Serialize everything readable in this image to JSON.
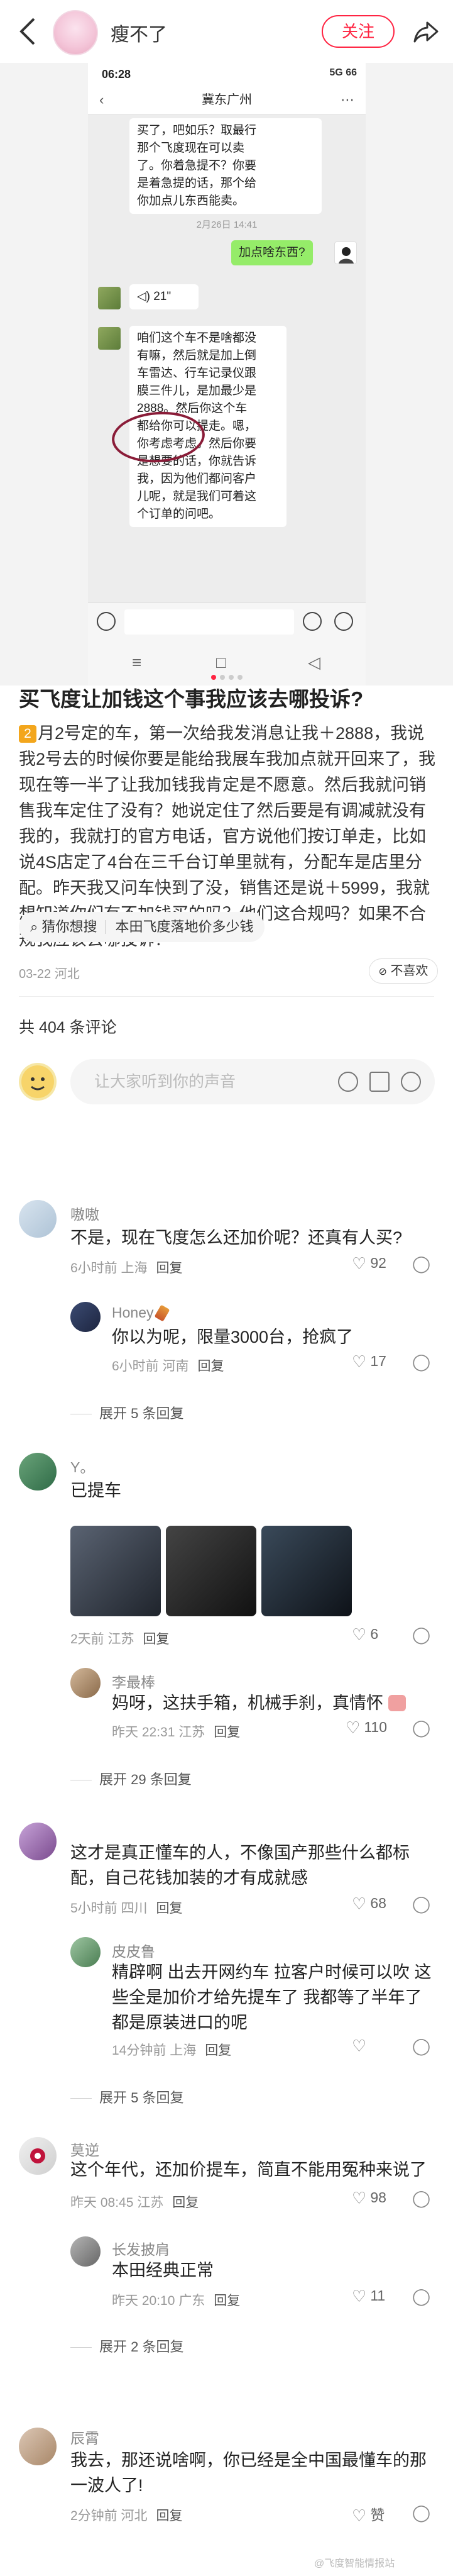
{
  "header": {
    "username": "瘦不了",
    "follow_label": "关注"
  },
  "screenshot": {
    "status_time": "06:28",
    "status_right": "5G 66",
    "chat_title": "冀东广州",
    "msg_top": "买了，吧如乐？取最行\n那个飞度现在可以卖\n了。你着急提不？你要\n是着急提的话，那个给\n你加点儿东西能卖。",
    "time_label": "2月26日 14:41",
    "my_msg": "加点啥东西?",
    "voice": "21\"",
    "msg_bottom": "咱们这个车不是啥都没\n有嘛，然后就是加上倒\n车雷达、行车记录仪跟\n膜三件儿，是加最少是\n2888。然后你这个车\n都给你可以提走。嗯，\n你考虑考虑。然后你要\n是想要的话，你就告诉\n我，因为他们都问客户\n儿呢，就是我们可着这\n个订单的问吧。"
  },
  "post": {
    "title": "买飞度让加钱这个事我应该去哪投诉?",
    "body_num": "2",
    "body": "月2号定的车，第一次给我发消息让我＋2888，我说我2号去的时候你要是能给我展车我加点就开回来了，我现在等一半了让我加钱我肯定是不愿意。然后我就问销售我车定住了没有？她说定住了然后要是有调减就没有我的，我就打的官方电话，官方说他们按订单走，比如说4S店定了4台在三千台订单里就有，分配车是店里分配。昨天我又问车快到了没，销售还是说＋5999，我就想知道你们有不加钱买的吗？他们这合规吗？如果不合规我应该去哪投诉？",
    "guess_label": "猜你想搜",
    "guess_query": "本田飞度落地价多少钱",
    "meta": "03-22 河北",
    "dislike_label": "不喜欢",
    "comment_count": "共 404 条评论",
    "comment_placeholder": "让大家听到你的声音"
  },
  "comments": [
    {
      "name": "嗷嗷",
      "text": "不是，现在飞度怎么还加价呢？还真有人买?",
      "meta": "6小时前 上海",
      "reply": "回复",
      "likes": "92",
      "replies": [
        {
          "name": "Honey",
          "text": "你以为呢，限量3000台，抢疯了",
          "meta": "6小时前 河南",
          "reply": "回复",
          "likes": "17"
        }
      ],
      "expand": "展开 5 条回复"
    },
    {
      "name": "Y。",
      "text": "已提车",
      "meta": "2天前 江苏",
      "reply": "回复",
      "likes": "6",
      "replies": [
        {
          "name": "李最棒",
          "text": "妈呀，这扶手箱，机械手刹，真情怀",
          "meta": "昨天 22:31 江苏",
          "reply": "回复",
          "likes": "110"
        }
      ],
      "expand": "展开 29 条回复"
    },
    {
      "name": "",
      "text": "这才是真正懂车的人，不像国产那些什么都标配，自己花钱加装的才有成就感",
      "meta": "5小时前 四川",
      "reply": "回复",
      "likes": "68",
      "replies": [
        {
          "name": "皮皮鲁",
          "text": "精辟啊 出去开网约车 拉客户时候可以吹 这些全是加价才给先提车了 我都等了半年了 都是原装进口的呢",
          "meta": "14分钟前 上海",
          "reply": "回复",
          "likes": "0"
        }
      ],
      "expand": "展开 5 条回复"
    },
    {
      "name": "莫逆",
      "text": "这个年代，还加价提车，简直不能用冤种来说了",
      "meta": "昨天 08:45 江苏",
      "reply": "回复",
      "likes": "98",
      "replies": [
        {
          "name": "长发披肩",
          "text": "本田经典正常",
          "meta": "昨天 20:10 广东",
          "reply": "回复",
          "likes": "11"
        }
      ],
      "expand": "展开 2 条回复"
    },
    {
      "name": "辰霄",
      "text": "我去，那还说啥啊，你已经是全中国最懂车的那一波人了!",
      "meta": "2分钟前 河北",
      "reply": "回复",
      "likes": "赞"
    }
  ],
  "watermark": "@飞度智能情报站"
}
